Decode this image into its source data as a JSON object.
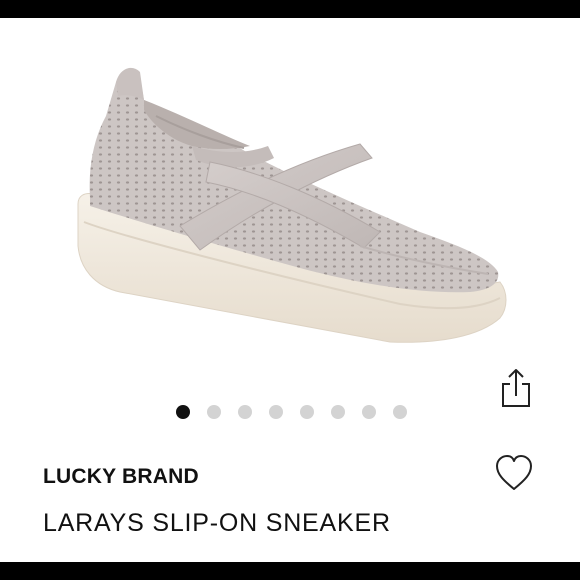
{
  "product": {
    "brand": "LUCKY BRAND",
    "name": "LARAYS SLIP-ON SNEAKER",
    "image_alt": "Grey knit slip-on sneaker with crisscross elastic straps and white sole"
  },
  "carousel": {
    "total": 8,
    "active_index": 1
  },
  "actions": {
    "share_icon": "share-icon",
    "like_icon": "heart-icon"
  },
  "colors": {
    "active_dot": "#111111",
    "inactive_dot": "#d3d3d3",
    "shoe_knit": "#cfc8c6",
    "sole": "#f1ebe1"
  }
}
